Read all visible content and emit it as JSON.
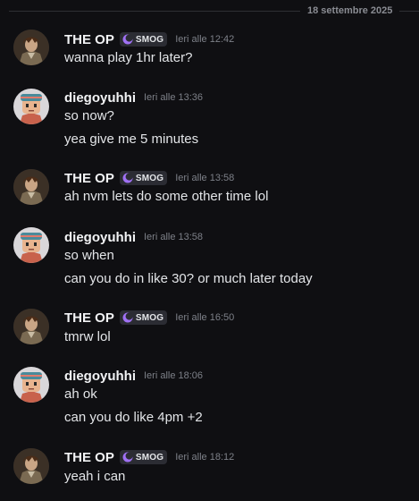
{
  "date_divider": "18 settembre 2025",
  "colors": {
    "background": "#0f0f12",
    "tag_icon": "#a071f4"
  },
  "messages": [
    {
      "author": "THE OP",
      "tag": "SMOG",
      "time": "Ieri alle 12:42",
      "lines": [
        "wanna play 1hr later?"
      ]
    },
    {
      "author": "diegoyuhhi",
      "time": "Ieri alle 13:36",
      "lines": [
        "so now?",
        "yea give me 5 minutes"
      ]
    },
    {
      "author": "THE OP",
      "tag": "SMOG",
      "time": "Ieri alle 13:58",
      "lines": [
        "ah nvm lets do some other time lol"
      ]
    },
    {
      "author": "diegoyuhhi",
      "time": "Ieri alle 13:58",
      "lines": [
        "so when",
        "can you do in like 30? or much later today"
      ]
    },
    {
      "author": "THE OP",
      "tag": "SMOG",
      "time": "Ieri alle 16:50",
      "lines": [
        "tmrw lol"
      ]
    },
    {
      "author": "diegoyuhhi",
      "time": "Ieri alle 18:06",
      "lines": [
        "ah ok",
        "can you do like 4pm +2"
      ]
    },
    {
      "author": "THE OP",
      "tag": "SMOG",
      "time": "Ieri alle 18:12",
      "lines": [
        "yeah i can"
      ]
    }
  ]
}
